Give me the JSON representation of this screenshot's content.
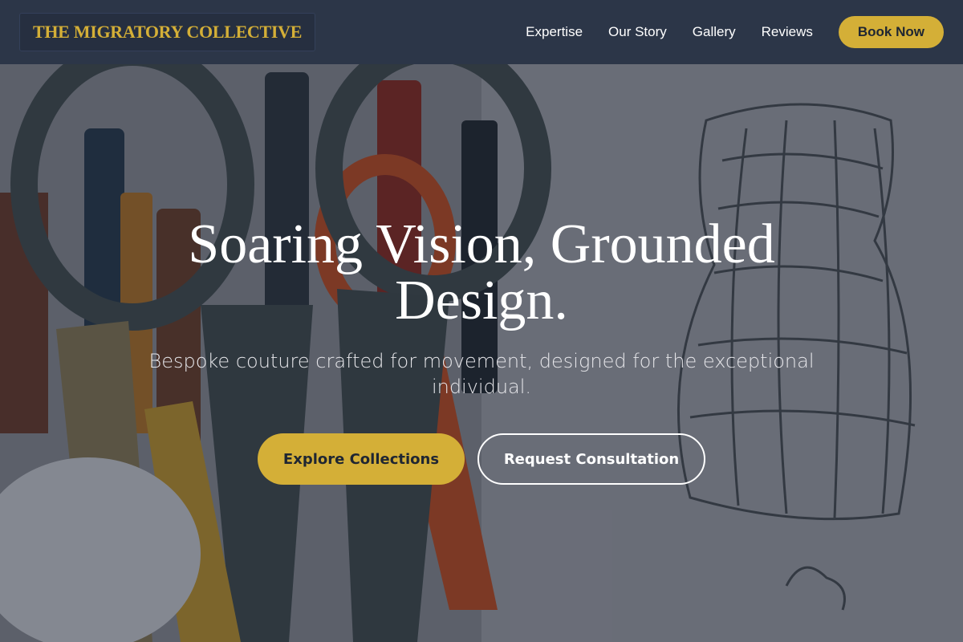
{
  "brand": {
    "name": "THE MIGRATORY COLLECTIVE",
    "accent_color": "#d4af37",
    "header_color": "#2c3648"
  },
  "nav": {
    "items": [
      {
        "label": "Expertise"
      },
      {
        "label": "Our Story"
      },
      {
        "label": "Gallery"
      },
      {
        "label": "Reviews"
      }
    ],
    "cta_label": "Book Now"
  },
  "hero": {
    "title": "Soaring Vision, Grounded Design.",
    "subtitle": "Bespoke couture crafted for movement, designed for the exceptional individual.",
    "primary_button": "Explore Collections",
    "secondary_button": "Request Consultation",
    "background_image": "scissors-and-pencils-with-dress-sketch-photo"
  }
}
